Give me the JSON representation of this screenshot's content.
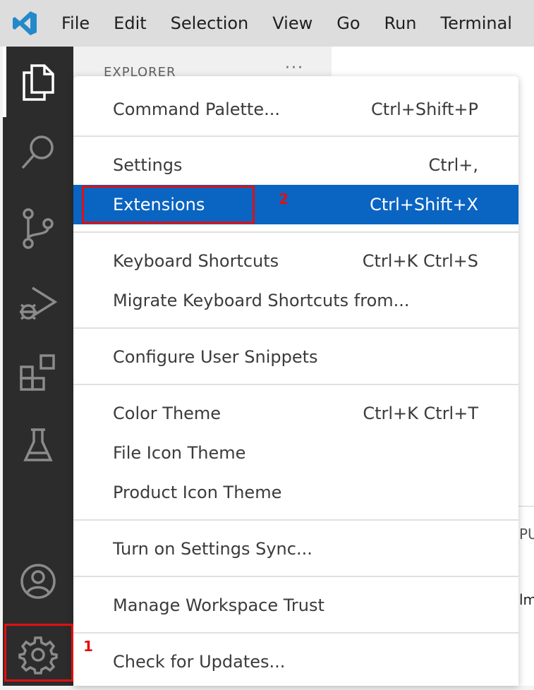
{
  "menubar": {
    "items": [
      "File",
      "Edit",
      "Selection",
      "View",
      "Go",
      "Run",
      "Terminal"
    ]
  },
  "activity_bar": {
    "icons": [
      "explorer-icon",
      "search-icon",
      "source-control-icon",
      "run-debug-icon",
      "extensions-icon",
      "testing-icon",
      "account-icon",
      "manage-gear-icon"
    ]
  },
  "sidebar": {
    "title": "EXPLORER",
    "more": "···"
  },
  "editor": {
    "panel_fragment_1": "PU",
    "panel_fragment_2": "lm."
  },
  "context_menu": {
    "items": [
      {
        "label": "Command Palette...",
        "shortcut": "Ctrl+Shift+P"
      },
      {
        "label": "Settings",
        "shortcut": "Ctrl+,"
      },
      {
        "label": "Extensions",
        "shortcut": "Ctrl+Shift+X"
      },
      {
        "label": "Keyboard Shortcuts",
        "shortcut": "Ctrl+K Ctrl+S"
      },
      {
        "label": "Migrate Keyboard Shortcuts from...",
        "shortcut": ""
      },
      {
        "label": "Configure User Snippets",
        "shortcut": ""
      },
      {
        "label": "Color Theme",
        "shortcut": "Ctrl+K Ctrl+T"
      },
      {
        "label": "File Icon Theme",
        "shortcut": ""
      },
      {
        "label": "Product Icon Theme",
        "shortcut": ""
      },
      {
        "label": "Turn on Settings Sync...",
        "shortcut": ""
      },
      {
        "label": "Manage Workspace Trust",
        "shortcut": ""
      },
      {
        "label": "Check for Updates...",
        "shortcut": ""
      }
    ],
    "highlighted": "Extensions"
  },
  "annotations": {
    "step1": "1",
    "step2": "2"
  },
  "colors": {
    "highlight": "#0a64c2",
    "annotation": "#e01010",
    "activity_bar": "#2c2c2c",
    "vscode_logo": "#2489ca"
  }
}
